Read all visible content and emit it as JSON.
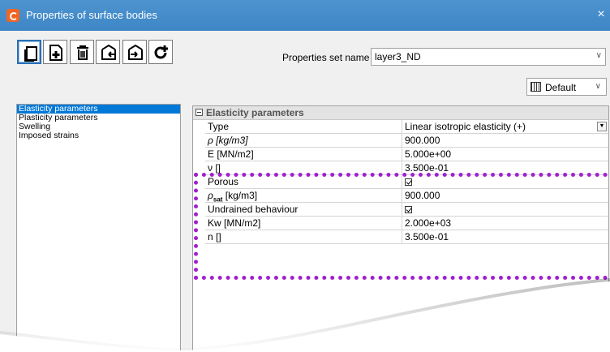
{
  "window": {
    "title": "Properties of surface bodies",
    "close_glyph": "×"
  },
  "toolbar": {
    "buttons": [
      {
        "name": "copy-properties-button",
        "icon": "copy-icon"
      },
      {
        "name": "add-properties-button",
        "icon": "add-document-icon"
      },
      {
        "name": "delete-button",
        "icon": "trash-icon"
      },
      {
        "name": "import-button",
        "icon": "import-icon"
      },
      {
        "name": "export-button",
        "icon": "export-icon"
      },
      {
        "name": "refresh-add-button",
        "icon": "refresh-add-icon"
      }
    ],
    "properties_set_label": "Properties set name",
    "properties_set_value": "layer3_ND",
    "default_label": "Default"
  },
  "sidebar": {
    "items": [
      {
        "label": "Elasticity parameters",
        "selected": true
      },
      {
        "label": "Plasticity parameters",
        "selected": false
      },
      {
        "label": "Swelling",
        "selected": false
      },
      {
        "label": "Imposed strains",
        "selected": false
      }
    ]
  },
  "grid": {
    "section": "Elasticity parameters",
    "rows": [
      {
        "key": "Type",
        "value": "Linear isotropic elasticity (+)"
      },
      {
        "key": "ρ [kg/m3]",
        "value": "900.000"
      },
      {
        "key": "E [MN/m2]",
        "value": "5.000e+00"
      },
      {
        "key": "ν []",
        "value": "3.500e-01"
      },
      {
        "key": "Porous",
        "value": ""
      },
      {
        "key_main": "ρ",
        "key_sub": "sat",
        "key_rest": " [kg/m3]",
        "value": "900.000"
      },
      {
        "key": "Undrained behaviour",
        "value": ""
      },
      {
        "key": "Kw [MN/m2]",
        "value": "2.000e+03"
      },
      {
        "key": "n []",
        "value": "3.500e-01"
      }
    ]
  },
  "colors": {
    "title_bar": "#3e86c6",
    "selection": "#0078d7",
    "highlight_dots": "#a020d0"
  }
}
